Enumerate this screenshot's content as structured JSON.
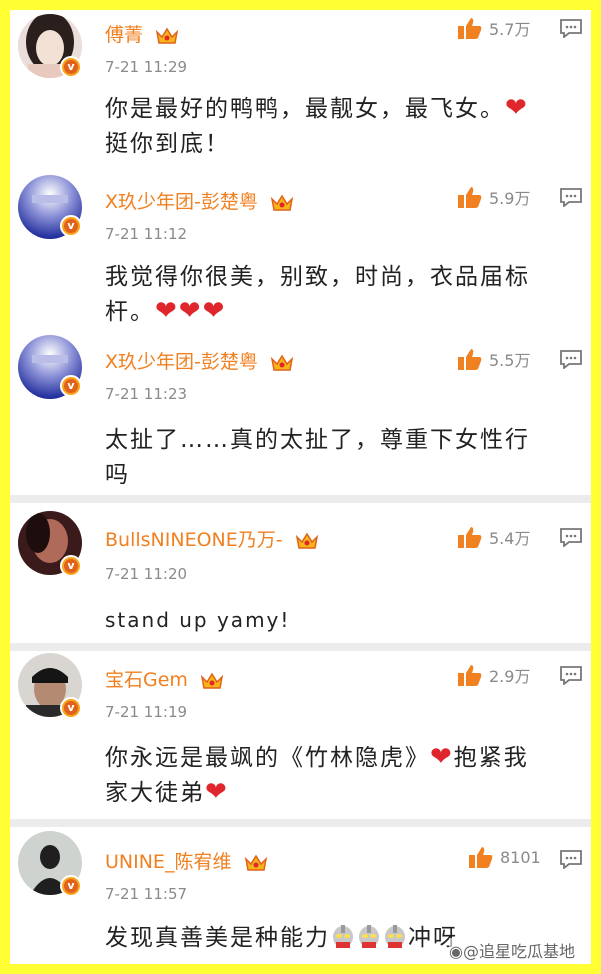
{
  "comments": [
    {
      "user": "傅菁",
      "likes": "5.7万",
      "time": "7-21 11:29",
      "text": "你是最好的鸭鸭，最靓女，最飞女。",
      "text_after": "挺你到底！"
    },
    {
      "user": "X玖少年团-彭楚粤",
      "likes": "5.9万",
      "time": "7-21 11:12",
      "text": "我觉得你很美，别致，时尚，衣品届标",
      "text_after": "杆。"
    },
    {
      "user": "X玖少年团-彭楚粤",
      "likes": "5.5万",
      "time": "7-21 11:23",
      "text": "太扯了……真的太扯了，尊重下女性行",
      "text_after": "吗"
    },
    {
      "user": "BullsNINEONE乃万-",
      "likes": "5.4万",
      "time": "7-21 11:20",
      "text": "stand up yamy!"
    },
    {
      "user": "宝石Gem",
      "likes": "2.9万",
      "time": "7-21 11:19",
      "text": "你永远是最飒的《竹林隐虎》",
      "text_mid": "抱紧我",
      "text_after": "家大徒弟"
    },
    {
      "user": "UNINE_陈宥维",
      "likes": "8101",
      "time": "7-21 11:57",
      "text": "发现真善美是种能力",
      "text_after": "冲呀"
    }
  ],
  "watermark": "@追星吃瓜基地",
  "colors": {
    "border": "#ffff33",
    "name": "#f08020",
    "like": "#f08020",
    "heart": "#e0262d"
  }
}
